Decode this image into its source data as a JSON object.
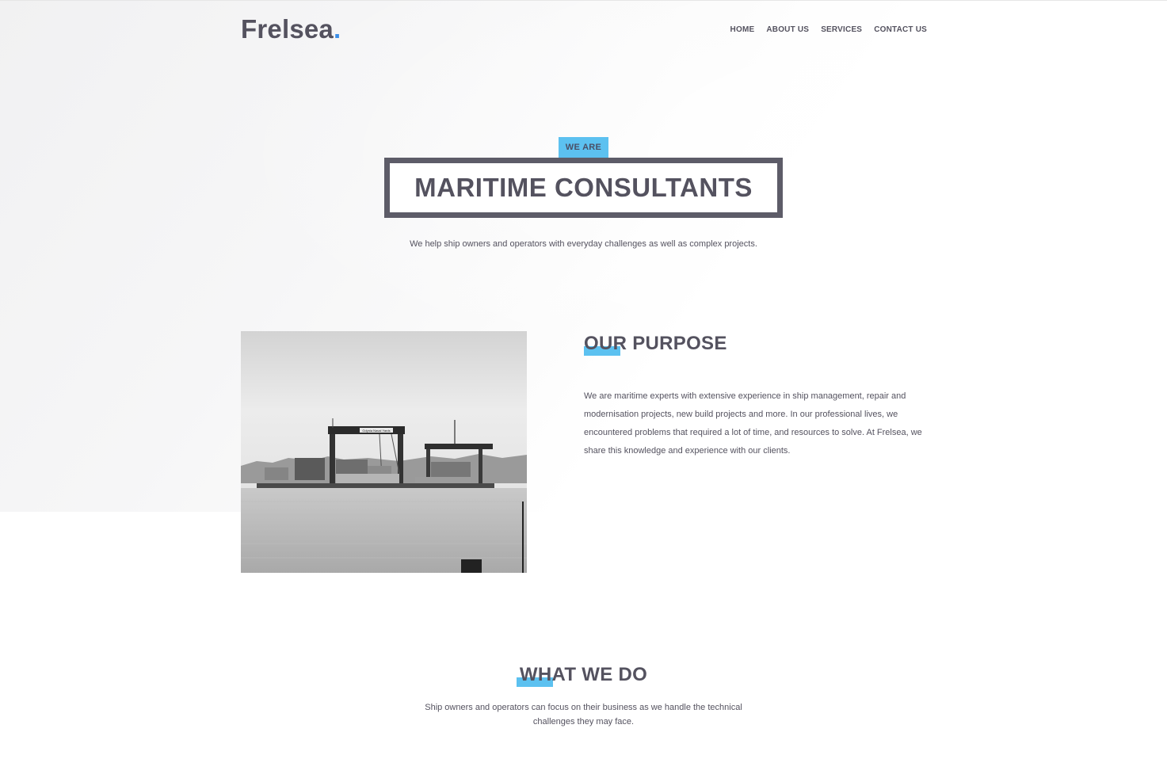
{
  "header": {
    "logo_text": "Frelsea",
    "logo_dot": ".",
    "nav": [
      "HOME",
      "ABOUT US",
      "SERVICES",
      "CONTACT US"
    ]
  },
  "hero": {
    "badge": "WE ARE",
    "title": "MARITIME CONSULTANTS",
    "subtitle": "We help ship owners and operators with everyday challenges as well as complex projects."
  },
  "purpose": {
    "heading": "OUR PURPOSE",
    "text": "We are maritime experts with extensive experience in ship management, repair and modernisation projects, new build projects and more. In our professional lives, we encountered problems that required a lot of time, and resources to solve. At Frelsea, we share this knowledge and experience with our clients.",
    "image_sign": "Gdynia Naval Yards"
  },
  "what_we_do": {
    "heading": "WHAT WE DO",
    "text": "Ship owners and operators can focus on their business as we handle the technical challenges they may face."
  },
  "colors": {
    "accent": "#5cc1f0",
    "logo_dot": "#3b8ee8",
    "text": "#54525f"
  }
}
